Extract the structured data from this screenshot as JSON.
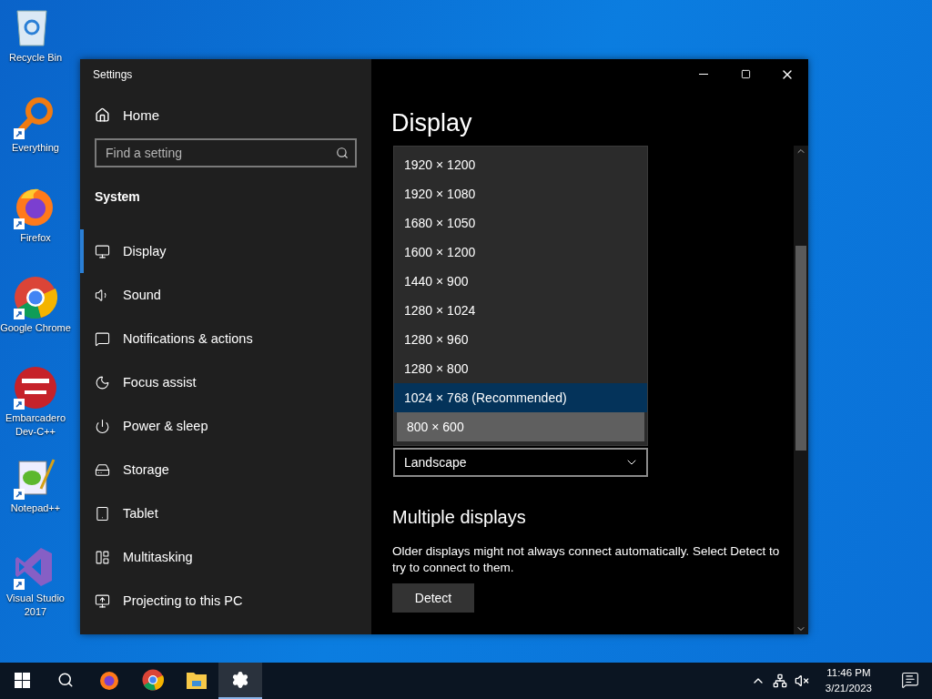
{
  "desktop_icons": [
    {
      "label": "Recycle Bin",
      "shortcut": false
    },
    {
      "label": "Everything",
      "shortcut": true
    },
    {
      "label": "Firefox",
      "shortcut": true
    },
    {
      "label": "Google Chrome",
      "shortcut": true
    },
    {
      "label": "Embarcadero Dev-C++",
      "shortcut": true
    },
    {
      "label": "Notepad++",
      "shortcut": true
    },
    {
      "label": "Visual Studio 2017",
      "shortcut": true
    }
  ],
  "window": {
    "title": "Settings"
  },
  "sidebar": {
    "home": "Home",
    "search": {
      "placeholder": "Find a setting"
    },
    "section": "System",
    "items": [
      {
        "label": "Display",
        "selected": true
      },
      {
        "label": "Sound",
        "selected": false
      },
      {
        "label": "Notifications & actions",
        "selected": false
      },
      {
        "label": "Focus assist",
        "selected": false
      },
      {
        "label": "Power & sleep",
        "selected": false
      },
      {
        "label": "Storage",
        "selected": false
      },
      {
        "label": "Tablet",
        "selected": false
      },
      {
        "label": "Multitasking",
        "selected": false
      },
      {
        "label": "Projecting to this PC",
        "selected": false
      }
    ]
  },
  "content": {
    "title": "Display",
    "resolution_options": [
      {
        "label": "1920 × 1200",
        "selected": false,
        "hovered": false
      },
      {
        "label": "1920 × 1080",
        "selected": false,
        "hovered": false
      },
      {
        "label": "1680 × 1050",
        "selected": false,
        "hovered": false
      },
      {
        "label": "1600 × 1200",
        "selected": false,
        "hovered": false
      },
      {
        "label": "1440 × 900",
        "selected": false,
        "hovered": false
      },
      {
        "label": "1280 × 1024",
        "selected": false,
        "hovered": false
      },
      {
        "label": "1280 × 960",
        "selected": false,
        "hovered": false
      },
      {
        "label": "1280 × 800",
        "selected": false,
        "hovered": false
      },
      {
        "label": "1024 × 768 (Recommended)",
        "selected": true,
        "hovered": false
      },
      {
        "label": "800 × 600",
        "selected": false,
        "hovered": true
      }
    ],
    "orientation": "Landscape",
    "multiple_heading": "Multiple displays",
    "multiple_text": "Older displays might not always connect automatically. Select Detect to try to connect to them.",
    "detect_button": "Detect"
  },
  "taskbar": {
    "apps": [
      {
        "active": false
      },
      {
        "active": false
      },
      {
        "active": false
      },
      {
        "active": true
      }
    ],
    "time": "11:46 PM",
    "date": "3/21/2023"
  }
}
